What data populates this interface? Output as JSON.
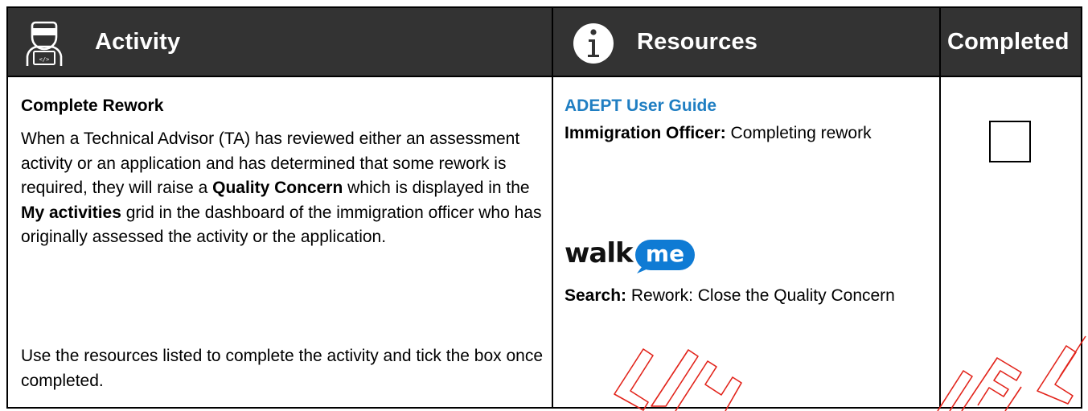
{
  "header": {
    "activity": "Activity",
    "resources": "Resources",
    "completed": "Completed"
  },
  "activity": {
    "title": "Complete Rework",
    "para1_a": "When a Technical Advisor (TA) has reviewed either an assessment activity or an application and has determined that some rework is required, they will raise a ",
    "para1_b": "Quality Concern",
    "para1_c": " which is displayed in the ",
    "para1_d": "My activities",
    "para1_e": " grid in the dashboard of the immigration officer who has originally assessed the activity or the application.",
    "para2": "Use the resources listed to complete the activity and tick the box once completed."
  },
  "resources": {
    "guide_link": "ADEPT User Guide",
    "officer_label": "Immigration Officer:",
    "officer_text": " Completing rework",
    "walkme_logo_text": "walkme",
    "search_label": "Search:",
    "search_text": " Rework: Close the Quality Concern"
  },
  "completed": {
    "checked": false
  },
  "watermark_text": "SAMPLE",
  "colors": {
    "header_bg": "#333333",
    "link": "#1f7ec2",
    "walkme_blue": "#0f7bd4",
    "watermark": "#e2231a"
  }
}
